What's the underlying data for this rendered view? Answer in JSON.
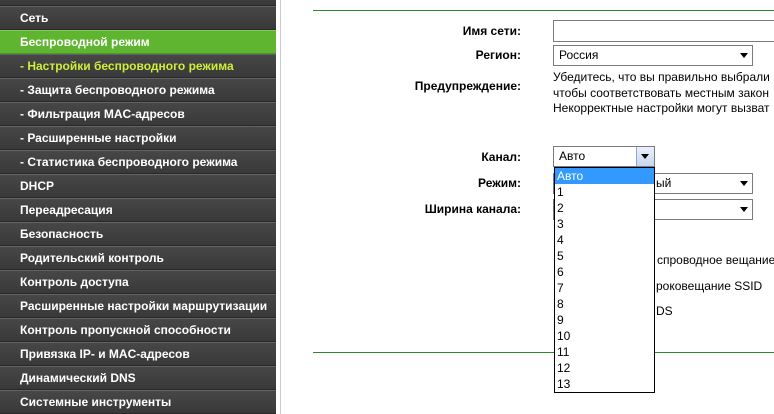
{
  "sidebar": {
    "items": [
      {
        "label": "Сеть",
        "active": false
      },
      {
        "label": "Беспроводной режим",
        "active": true
      },
      {
        "label": "- Настройки беспроводного режима",
        "active": true
      },
      {
        "label": "- Защита беспроводного режима",
        "active": false
      },
      {
        "label": "- Фильтрация MAC-адресов",
        "active": false
      },
      {
        "label": "- Расширенные настройки",
        "active": false
      },
      {
        "label": "- Статистика беспроводного режима",
        "active": false
      },
      {
        "label": "DHCP",
        "active": false
      },
      {
        "label": "Переадресация",
        "active": false
      },
      {
        "label": "Безопасность",
        "active": false
      },
      {
        "label": "Родительский контроль",
        "active": false
      },
      {
        "label": "Контроль доступа",
        "active": false
      },
      {
        "label": "Расширенные настройки маршрутизации",
        "active": false
      },
      {
        "label": "Контроль пропускной способности",
        "active": false
      },
      {
        "label": "Привязка IP- и MAC-адресов",
        "active": false
      },
      {
        "label": "Динамический DNS",
        "active": false
      },
      {
        "label": "Системные инструменты",
        "active": false
      }
    ]
  },
  "form": {
    "ssid": {
      "label": "Имя сети:"
    },
    "region": {
      "label": "Регион:",
      "value": "Россия"
    },
    "warning": {
      "label": "Предупреждение:",
      "lines": [
        "Убедитесь, что вы правильно выбрали",
        "чтобы соответствовать местным закон",
        "Некорректные настройки могут вызват"
      ]
    },
    "channel": {
      "label": "Канал:",
      "value": "Авто",
      "highlighted_index": 0,
      "options": [
        "Авто",
        "1",
        "2",
        "3",
        "4",
        "5",
        "6",
        "7",
        "8",
        "9",
        "10",
        "11",
        "12",
        "13"
      ]
    },
    "mode": {
      "label": "Режим:",
      "visible_value": "ый"
    },
    "channel_width": {
      "label": "Ширина канала:"
    },
    "partial_labels": [
      "спроводное вещание",
      "роковещание SSID",
      "DS"
    ]
  },
  "icons": {
    "dropdown_arrow": "dropdown-arrow-icon"
  },
  "colors": {
    "sidebar_bg": "#363636",
    "sidebar_active_bg": "#5fb430",
    "sub_active_text": "#cdef3a",
    "divider_green": "#2c8a2c",
    "option_highlight": "#3399ff"
  }
}
